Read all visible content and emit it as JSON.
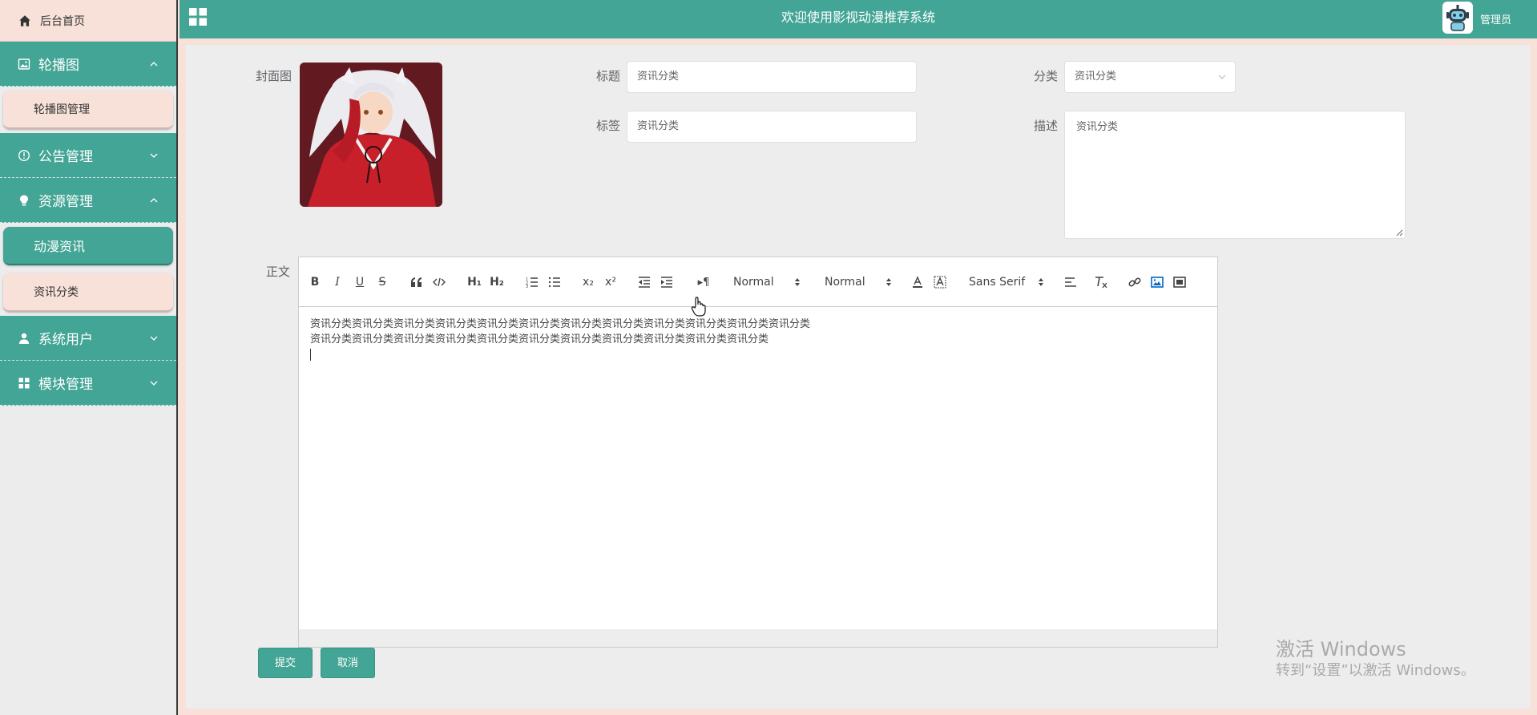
{
  "app": {
    "title": "欢迎使用影视动漫推荐系统",
    "user": "管理员"
  },
  "sidebar": {
    "home": "后台首页",
    "groups": [
      {
        "label": "轮播图",
        "icon": "image-icon",
        "expanded": true,
        "items": [
          "轮播图管理"
        ]
      },
      {
        "label": "公告管理",
        "icon": "info-circle-icon",
        "expanded": false,
        "items": []
      },
      {
        "label": "资源管理",
        "icon": "bulb-icon",
        "expanded": true,
        "items": [
          "动漫资讯",
          "资讯分类"
        ]
      },
      {
        "label": "系统用户",
        "icon": "user-icon",
        "expanded": false,
        "items": []
      },
      {
        "label": "模块管理",
        "icon": "grid-icon",
        "expanded": false,
        "items": []
      }
    ],
    "active_item": "动漫资讯"
  },
  "form": {
    "cover_label": "封面图",
    "title_label": "标题",
    "title_value": "资讯分类",
    "category_label": "分类",
    "category_value": "资讯分类",
    "tags_label": "标签",
    "tags_value": "资讯分类",
    "desc_label": "描述",
    "desc_value": "资讯分类",
    "body_label": "正文",
    "body_lines": [
      "资讯分类资讯分类资讯分类资讯分类资讯分类资讯分类资讯分类资讯分类资讯分类资讯分类资讯分类资讯分类",
      "资讯分类资讯分类资讯分类资讯分类资讯分类资讯分类资讯分类资讯分类资讯分类资讯分类资讯分类"
    ],
    "submit": "提交",
    "cancel": "取消"
  },
  "editor_toolbar": {
    "bold": "B",
    "italic": "I",
    "underline": "U",
    "strike": "S",
    "h1": "H₁",
    "h2": "H₂",
    "sub": "x₂",
    "sup": "x²",
    "header_pick": "Normal",
    "size_pick": "Normal",
    "font_pick": "Sans Serif",
    "direction": "▸¶"
  },
  "watermark": {
    "line1": "激活 Windows",
    "line2": "转到“设置”以激活 Windows。"
  },
  "colors": {
    "accent": "#43a595",
    "pink": "#f7e1d9",
    "panel": "#ededed"
  }
}
